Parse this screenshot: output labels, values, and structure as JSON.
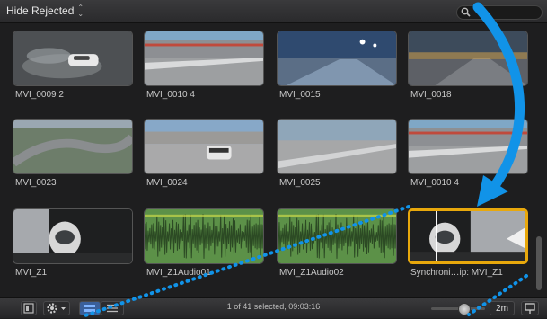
{
  "toolbar": {
    "filter_label": "Hide Rejected",
    "filter_stepper": "⌃⌄"
  },
  "clips": [
    {
      "label": "MVI_0009 2",
      "scene": "car-drift"
    },
    {
      "label": "MVI_0010 4",
      "scene": "track-stands"
    },
    {
      "label": "MVI_0015",
      "scene": "night-track"
    },
    {
      "label": "MVI_0018",
      "scene": "dusk-road"
    },
    {
      "label": "MVI_0023",
      "scene": "aerial-track"
    },
    {
      "label": "MVI_0024",
      "scene": "car-chase"
    },
    {
      "label": "MVI_0025",
      "scene": "track-road"
    },
    {
      "label": "MVI_0010 4",
      "scene": "track-stands"
    },
    {
      "label": "MVI_Z1",
      "scene": "driver-helmet"
    },
    {
      "label": "MVI_Z1Audio01",
      "scene": "audio-waveform"
    },
    {
      "label": "MVI_Z1Audio02",
      "scene": "audio-waveform"
    },
    {
      "label": "Synchroni…ip: MVI_Z1",
      "scene": "driver-helmet-selected"
    }
  ],
  "status": {
    "text": "1 of 41 selected, 09:03:16"
  },
  "zoom": {
    "duration_label": "2m"
  },
  "colors": {
    "accent_arrow": "#1193e8",
    "selection": "#e8a80c",
    "audio_green": "#5c9148"
  }
}
